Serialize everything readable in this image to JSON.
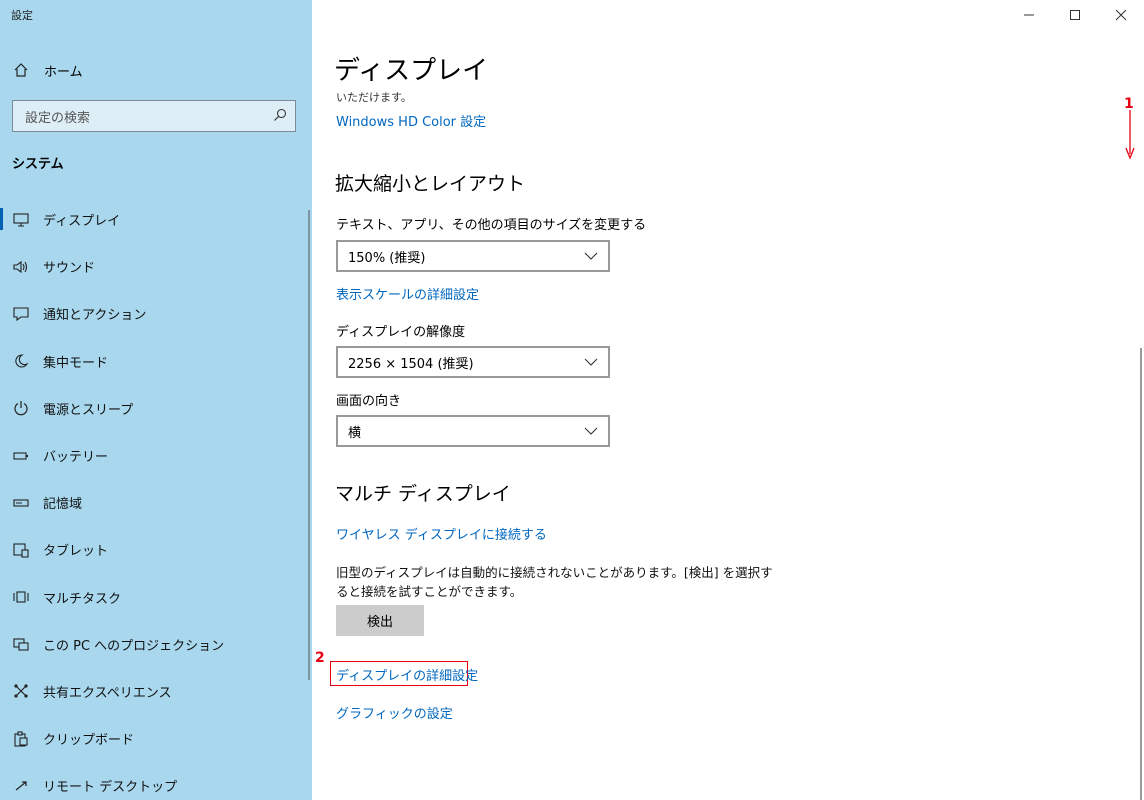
{
  "window": {
    "title": "設定",
    "buttons": [
      "minimize-icon",
      "maximize-icon",
      "close-icon"
    ]
  },
  "sidebar": {
    "home_label": "ホーム",
    "search_placeholder": "設定の検索",
    "section": "システム",
    "items": [
      {
        "label": "ディスプレイ",
        "icon": "monitor-icon",
        "active": true
      },
      {
        "label": "サウンド",
        "icon": "speaker-icon"
      },
      {
        "label": "通知とアクション",
        "icon": "notification-icon"
      },
      {
        "label": "集中モード",
        "icon": "moon-icon"
      },
      {
        "label": "電源とスリープ",
        "icon": "power-icon"
      },
      {
        "label": "バッテリー",
        "icon": "battery-icon"
      },
      {
        "label": "記憶域",
        "icon": "storage-icon"
      },
      {
        "label": "タブレット",
        "icon": "tablet-icon"
      },
      {
        "label": "マルチタスク",
        "icon": "multitask-icon"
      },
      {
        "label": "この PC へのプロジェクション",
        "icon": "projection-icon"
      },
      {
        "label": "共有エクスペリエンス",
        "icon": "shared-experience-icon"
      },
      {
        "label": "クリップボード",
        "icon": "clipboard-icon"
      },
      {
        "label": "リモート デスクトップ",
        "icon": "remote-desktop-icon"
      }
    ]
  },
  "main": {
    "title": "ディスプレイ",
    "cutoff_text": "いただけます。",
    "hd_color_link": "Windows HD Color 設定",
    "scale_heading": "拡大縮小とレイアウト",
    "text_size_label": "テキスト、アプリ、その他の項目のサイズを変更する",
    "text_size_value": "150% (推奨)",
    "scale_link": "表示スケールの詳細設定",
    "resolution_label": "ディスプレイの解像度",
    "resolution_value": "2256 × 1504 (推奨)",
    "orientation_label": "画面の向き",
    "orientation_value": "横",
    "multi_heading": "マルチ ディスプレイ",
    "wireless_link": "ワイヤレス ディスプレイに接続する",
    "old_display_desc": "旧型のディスプレイは自動的に接続されないことがあります。[検出] を選択すると接続を試すことができます。",
    "detect_button": "検出",
    "advanced_link": "ディスプレイの詳細設定",
    "graphics_link": "グラフィックの設定"
  },
  "annotations": {
    "marker1": "1",
    "marker2": "2",
    "color": "#e60012"
  },
  "colors": {
    "sidebar_bg": "#a9d8ee",
    "accent": "#0067c0"
  }
}
